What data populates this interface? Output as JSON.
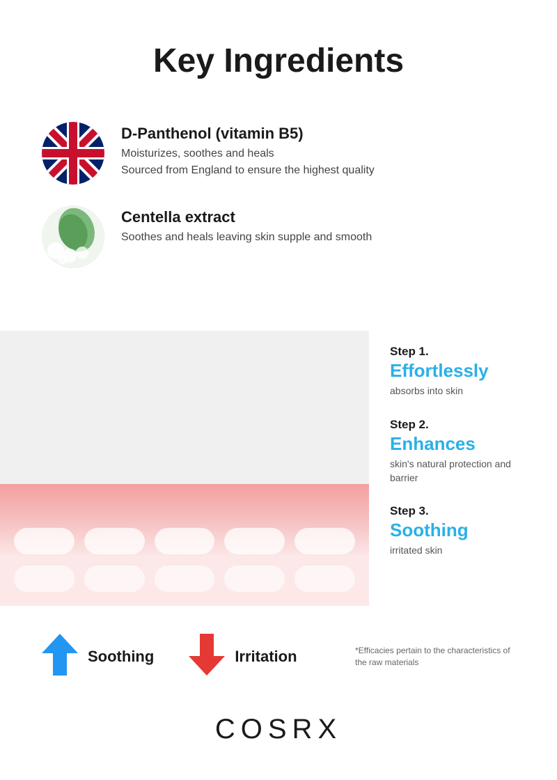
{
  "header": {
    "title": "Key Ingredients"
  },
  "ingredients": [
    {
      "id": "dpanthenol",
      "name": "D-Panthenol (vitamin B5)",
      "descriptions": [
        "Moisturizes, soothes and heals",
        "Sourced from England to ensure the highest quality"
      ],
      "icon_type": "uk_flag"
    },
    {
      "id": "centella",
      "name": "Centella extract",
      "descriptions": [
        "Soothes and heals leaving skin supple and smooth"
      ],
      "icon_type": "centella"
    }
  ],
  "steps": [
    {
      "number": "Step 1.",
      "keyword": "Effortlessly",
      "detail": "absorbs into skin"
    },
    {
      "number": "Step 2.",
      "keyword": "Enhances",
      "detail": "skin's natural protection and barrier"
    },
    {
      "number": "Step 3.",
      "keyword": "Soothing",
      "detail": "irritated skin"
    }
  ],
  "legend": {
    "soothing_label": "Soothing",
    "irritation_label": "Irritation",
    "efficacy_note": "*Efficacies pertain to the characteristics of the raw materials"
  },
  "brand": {
    "name": "COSRX"
  }
}
